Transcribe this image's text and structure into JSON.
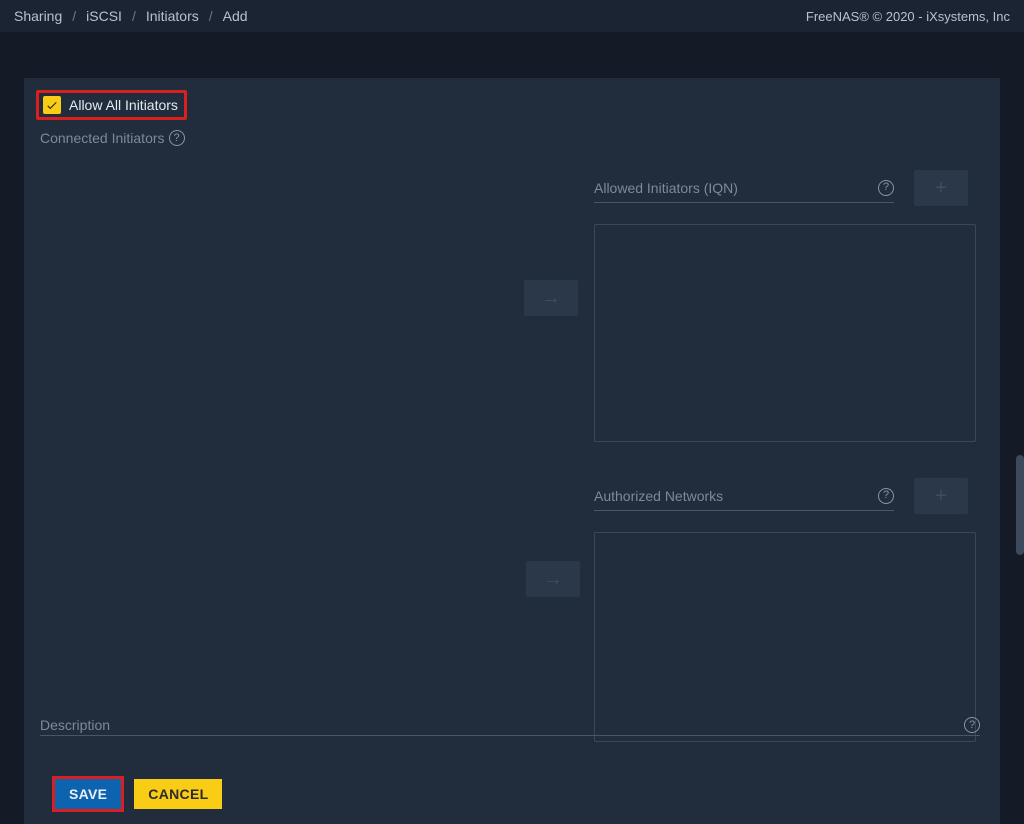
{
  "breadcrumb": {
    "items": [
      "Sharing",
      "iSCSI",
      "Initiators",
      "Add"
    ],
    "sep": "/"
  },
  "copyright": "FreeNAS® © 2020 - iXsystems, Inc",
  "form": {
    "allow_all_label": "Allow All Initiators",
    "connected_label": "Connected Initiators",
    "allowed_label": "Allowed Initiators (IQN)",
    "networks_label": "Authorized Networks",
    "description_label": "Description"
  },
  "buttons": {
    "save": "SAVE",
    "cancel": "CANCEL"
  }
}
